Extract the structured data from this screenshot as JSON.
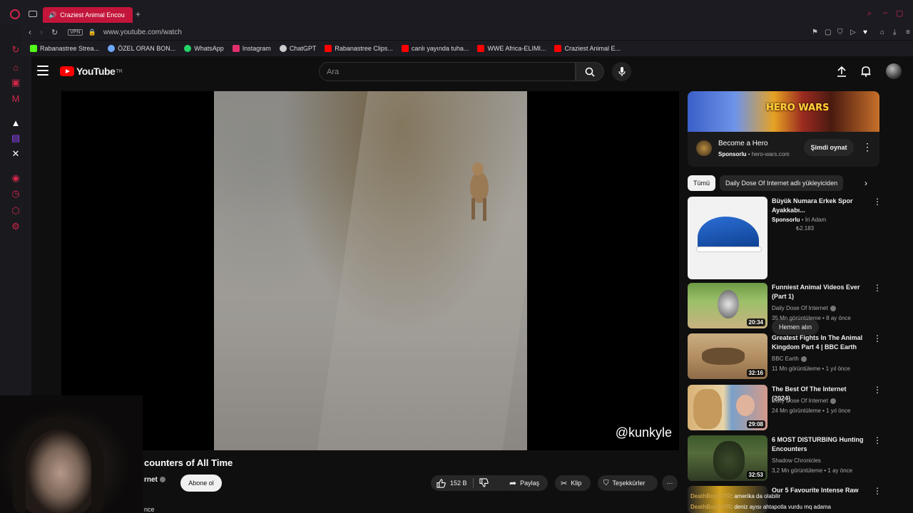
{
  "browser": {
    "tab_title": "Craziest Animal Encou",
    "address": "www.youtube.com/watch",
    "vpn_label": "VPN",
    "bookmarks": [
      {
        "label": "Rabanastree Strea...",
        "color": "#53fc18"
      },
      {
        "label": "ÖZEL ORAN BON...",
        "color": "#6ea8ff"
      },
      {
        "label": "WhatsApp",
        "color": "#25d366"
      },
      {
        "label": "Instagram",
        "color": "#e1306c"
      },
      {
        "label": "ChatGPT",
        "color": "#cccccc"
      },
      {
        "label": "Rabanastree Clips...",
        "color": "#ff0000"
      },
      {
        "label": "canlı yayında tuha...",
        "color": "#ff0000"
      },
      {
        "label": "WWE Africa-ELIMI...",
        "color": "#ff0000"
      },
      {
        "label": "Craziest Animal E...",
        "color": "#ff0000"
      }
    ]
  },
  "youtube": {
    "logo_text": "YouTube",
    "logo_region": "TR",
    "search_placeholder": "Ara"
  },
  "player": {
    "watermark": "@kunkyle"
  },
  "video": {
    "title": "counters of All Time",
    "channel": "rnet",
    "subscribe_label": "Abone ol",
    "like_count": "152 B",
    "share_label": "Paylaş",
    "clip_label": "Klip",
    "thanks_label": "Teşekkürler",
    "desc_peek": "nce"
  },
  "ad": {
    "banner_logo": "HERO WARS",
    "title": "Become a Hero",
    "sponsored": "Sponsorlu",
    "domain": "hero-wars.com",
    "cta": "Şimdi oynat"
  },
  "chips": {
    "all": "Tümü",
    "channel": "Daily Dose Of Internet adlı yükleyiciden"
  },
  "shop_ad": {
    "title": "Büyük Numara Erkek Spor Ayakkabı...",
    "sponsored": "Sponsorlu",
    "seller": "İri Adam",
    "price": "₺2.183",
    "cta": "Hemen alın"
  },
  "recommendations": [
    {
      "title": "Funniest Animal Videos Ever (Part 1)",
      "channel": "Daily Dose Of Internet",
      "meta": "35 Mn görüntüleme • 8 ay önce",
      "duration": "20:34"
    },
    {
      "title": "Greatest Fights In The Animal Kingdom Part 4 | BBC Earth",
      "channel": "BBC Earth",
      "meta": "11 Mn görüntüleme • 1 yıl önce",
      "duration": "32:16"
    },
    {
      "title": "The Best Of The Internet (2024)",
      "channel": "Daily Dose Of Internet",
      "meta": "24 Mn görüntüleme • 1 yıl önce",
      "duration": "29:08"
    },
    {
      "title": "6 MOST DISTURBING Hunting Encounters",
      "channel": "Shadow Chronicles",
      "meta": "3,2 Mn görüntüleme • 1 ay önce",
      "duration": "32:53"
    },
    {
      "title": "Our 5 Favourite Intense Raw",
      "channel": "",
      "meta": "",
      "duration": ""
    }
  ],
  "chat": [
    {
      "user": "DeathBoy54TR",
      "text": ": amerika da olabilir"
    },
    {
      "user": "DeathBoy54TR",
      "text": ": deniz ayısı ahtapotla vurdu mq adama"
    }
  ]
}
